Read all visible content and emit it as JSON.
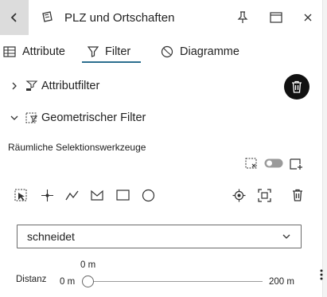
{
  "header": {
    "title": "PLZ und Ortschaften",
    "icons": [
      "back-arrow-icon",
      "layer-icon",
      "pin-icon",
      "maximize-icon",
      "close-icon"
    ]
  },
  "tabs": [
    {
      "label": "Attribute",
      "icon": "table-icon"
    },
    {
      "label": "Filter",
      "icon": "funnel-icon",
      "active": true
    },
    {
      "label": "Diagramme",
      "icon": "chart-icon"
    }
  ],
  "sections": {
    "attribute_filter": {
      "label": "Attributfilter",
      "expanded": false
    },
    "geometric_filter": {
      "label": "Geometrischer Filter",
      "expanded": true
    }
  },
  "spatial_tools": {
    "heading": "Räumliche Selektionswerkzeuge",
    "tools": [
      "select-features-icon",
      "point-icon",
      "line-icon",
      "polygon-icon",
      "rectangle-icon",
      "circle-icon"
    ],
    "right_tools": [
      "locate-icon",
      "extent-icon",
      "trash-icon"
    ]
  },
  "operator": {
    "selected": "schneidet"
  },
  "distance": {
    "label": "Distanz",
    "current": "0 m",
    "min": "0 m",
    "max": "200 m",
    "value_fraction": 0
  },
  "colors": {
    "accent": "#2c6e8f",
    "header_back_bg": "#dcdcdc",
    "dark": "#111111"
  }
}
